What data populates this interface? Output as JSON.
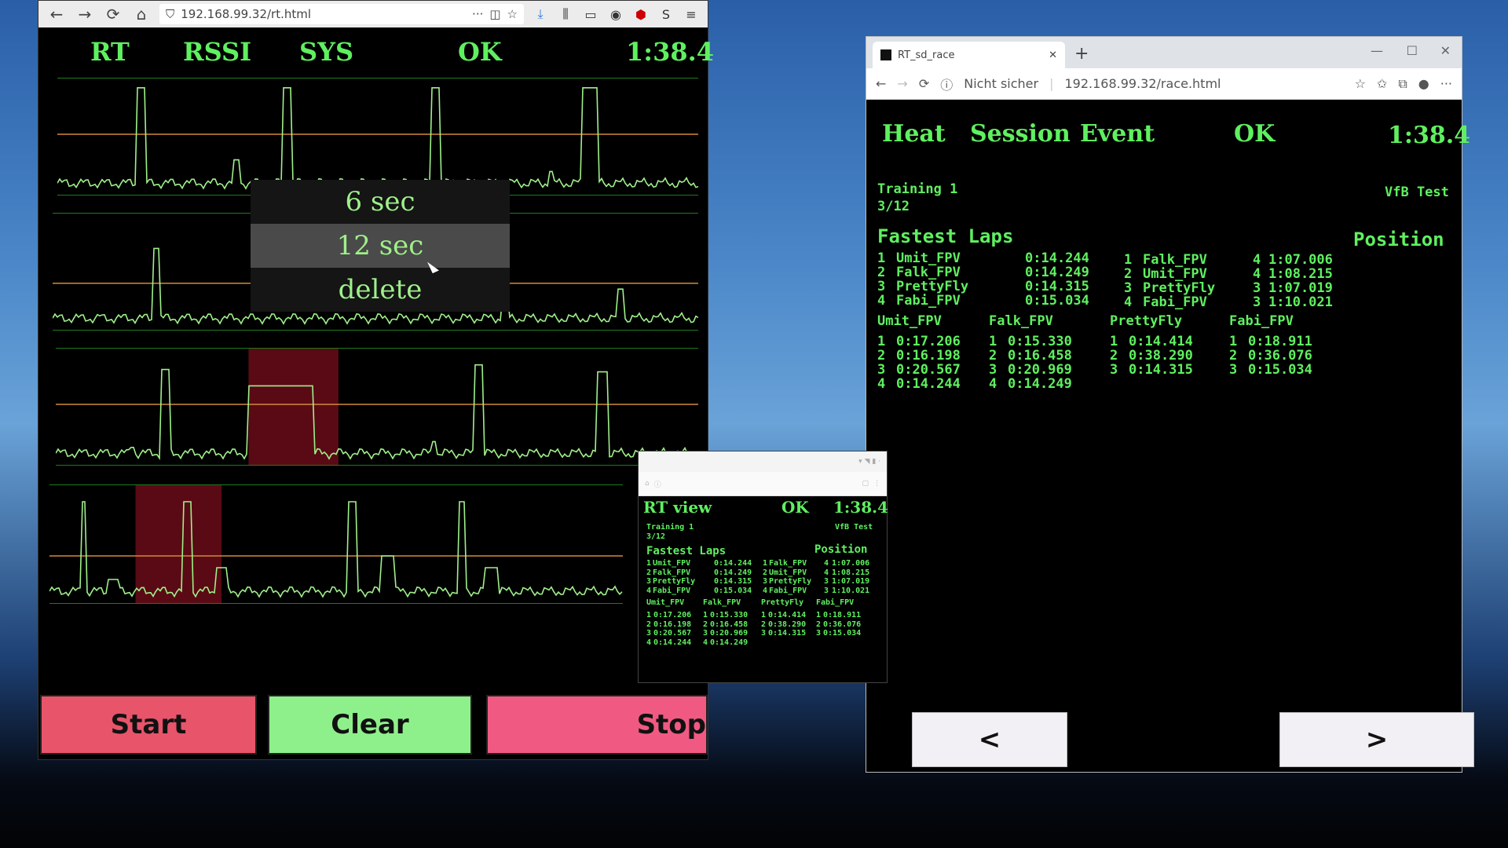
{
  "left_window": {
    "url": "192.168.99.32/rt.html",
    "header": {
      "rt": "RT",
      "rssi": "RSSI",
      "sys": "SYS",
      "status": "OK",
      "time": "1:38.4"
    },
    "popup": {
      "items": [
        "6 sec",
        "12 sec",
        "delete"
      ],
      "selected_index": 1
    },
    "buttons": {
      "start": "Start",
      "clear": "Clear",
      "stop": "Stop"
    },
    "colors": {
      "trace": "#9ff08a",
      "threshold": "#d28a3a",
      "highlight": "#5a0a14",
      "start": "#e8546a",
      "clear": "#8ef08a",
      "stop": "#f05a82"
    }
  },
  "right_window": {
    "tab_title": "RT_sd_race",
    "address_prefix": "Nicht sicher",
    "url": "192.168.99.32/race.html",
    "header": {
      "heat": "Heat",
      "session": "Session",
      "event": "Event",
      "status": "OK",
      "time": "1:38.4"
    },
    "session_name": "Training 1",
    "session_progress": "3/12",
    "event_name": "VfB Test",
    "fastest_title": "Fastest Laps",
    "position_title": "Position",
    "fastest_laps": [
      {
        "rank": "1",
        "pilot": "Umit_FPV",
        "time": "0:14.244"
      },
      {
        "rank": "2",
        "pilot": "Falk_FPV",
        "time": "0:14.249"
      },
      {
        "rank": "3",
        "pilot": "PrettyFly",
        "time": "0:14.315"
      },
      {
        "rank": "4",
        "pilot": "Fabi_FPV",
        "time": "0:15.034"
      }
    ],
    "positions": [
      {
        "rank": "1",
        "pilot": "Falk_FPV",
        "laps": "4",
        "time": "1:07.006"
      },
      {
        "rank": "2",
        "pilot": "Umit_FPV",
        "laps": "4",
        "time": "1:08.215"
      },
      {
        "rank": "3",
        "pilot": "PrettyFly",
        "laps": "3",
        "time": "1:07.019"
      },
      {
        "rank": "4",
        "pilot": "Fabi_FPV",
        "laps": "3",
        "time": "1:10.021"
      }
    ],
    "pilots": [
      {
        "name": "Umit_FPV",
        "laps": [
          [
            "1",
            "0:17.206"
          ],
          [
            "2",
            "0:16.198"
          ],
          [
            "3",
            "0:20.567"
          ],
          [
            "4",
            "0:14.244"
          ]
        ]
      },
      {
        "name": "Falk_FPV",
        "laps": [
          [
            "1",
            "0:15.330"
          ],
          [
            "2",
            "0:16.458"
          ],
          [
            "3",
            "0:20.969"
          ],
          [
            "4",
            "0:14.249"
          ]
        ]
      },
      {
        "name": "PrettyFly",
        "laps": [
          [
            "1",
            "0:14.414"
          ],
          [
            "2",
            "0:38.290"
          ],
          [
            "3",
            "0:14.315"
          ]
        ]
      },
      {
        "name": "Fabi_FPV",
        "laps": [
          [
            "1",
            "0:18.911"
          ],
          [
            "2",
            "0:36.076"
          ],
          [
            "3",
            "0:15.034"
          ]
        ]
      }
    ],
    "nav": {
      "prev": "<",
      "next": ">"
    }
  },
  "phone_window": {
    "title": "RT view",
    "status": "OK",
    "time": "1:38.4"
  }
}
